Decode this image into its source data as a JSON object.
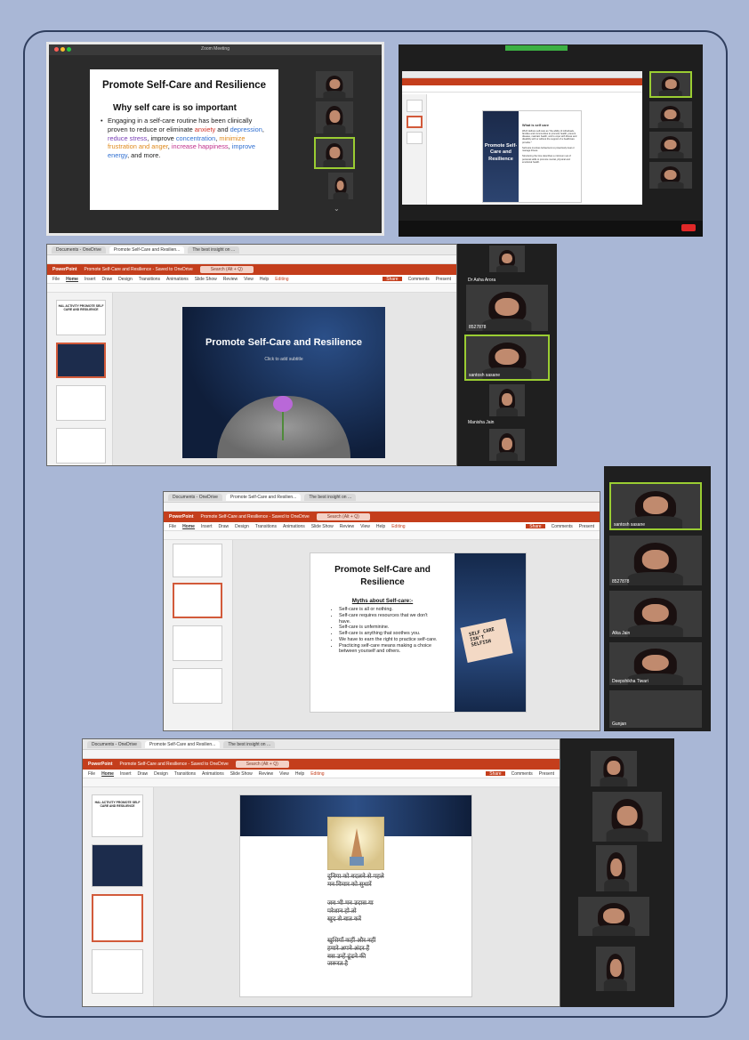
{
  "colors": {
    "page_bg": "#a9b7d6",
    "powerpoint_red": "#c43e1c",
    "active_speaker": "#9acd32",
    "slide_navy": "#1c2c4c"
  },
  "shot1": {
    "window_title": "Zoom Meeting",
    "slide_title": "Promote Self-Care and Resilience",
    "slide_heading": "Why self care is so important",
    "bullet": {
      "t1": "Engaging in a self-care routine has been clinically proven to reduce or eliminate ",
      "anxiety": "anxiety",
      "t2": " and ",
      "depression": "depression",
      "t3": ", ",
      "reduce_stress": "reduce stress",
      "t4": ", improve ",
      "concentration": "concentration",
      "t5": ", ",
      "minimize": "minimize frustration and anger",
      "t6": ", ",
      "happiness": "increase happiness",
      "t7": ", ",
      "energy": "improve energy",
      "t8": ", and more."
    }
  },
  "shot2": {
    "slide_title": "Promote Self-Care and Resilience",
    "heading": "What is self care",
    "text1": "WHO defines self-care as \"the ability of individuals, families and communities to promote health, prevent disease, maintain health, and to cope with illness and disability with or without the support of a healthcare provider.\"",
    "text2": "Self-care involves behaviours to proactively treat or manage illness.",
    "text3": "Structuring the time describes a minimum set of personal skills to promote mental, physical and emotional health."
  },
  "shot3": {
    "tabs": [
      "Documents - OneDrive",
      "Promote Self-Care and Resilien...",
      "The best insight on ..."
    ],
    "app": "PowerPoint",
    "doc_title": "Promote Self-Care and Resilience - Saved to OneDrive",
    "search": "Search (Alt + Q)",
    "ribbon": [
      "File",
      "Home",
      "Insert",
      "Draw",
      "Design",
      "Transitions",
      "Animations",
      "Slide Show",
      "Review",
      "View",
      "Help",
      "Editing"
    ],
    "actions": [
      "Share",
      "Comments",
      "Present"
    ],
    "thumb1": "HAL ACTIVITY PROMOTE SELF CARE AND RESILIENCE",
    "slide_title": "Promote Self-Care and Resilience",
    "subtitle": "Click to add subtitle",
    "participants": [
      "Dr Asha Arora",
      "8527878",
      "santosh sasane",
      "Manisha Jain"
    ]
  },
  "shot4": {
    "slide_title": "Promote Self-Care and Resilience",
    "myths_heading": "Myths about Self-care:-",
    "myths": [
      "Self-care is all or nothing.",
      "Self-care requires resources that we don't have.",
      "Self-care is unfeminine.",
      "Self-care is anything that soothes you.",
      "We have to earn the right to practice self-care.",
      "Practicing self-care means making a choice between yourself and others."
    ],
    "sign_text": "SELF CARE ISN'T SELFISH",
    "participants": [
      "santosh sasane",
      "8527878",
      "Alka Jain",
      "Deepshikha Tiwari",
      "Gunjan"
    ]
  },
  "shot5": {
    "hindi_lines_1": [
      "दुनिया को बदलने से पहले",
      "मन विचार को सुधारें"
    ],
    "hindi_lines_2": [
      "जब भी मन उदास या",
      "परेशान हो तो",
      "खुद से बात करें"
    ],
    "hindi_lines_3": [
      "खुशियाँ कहीं और नहीं",
      "हमारे अपने अंदर हैं",
      "बस उन्हें ढूंढने की",
      "जरूरत है"
    ]
  }
}
